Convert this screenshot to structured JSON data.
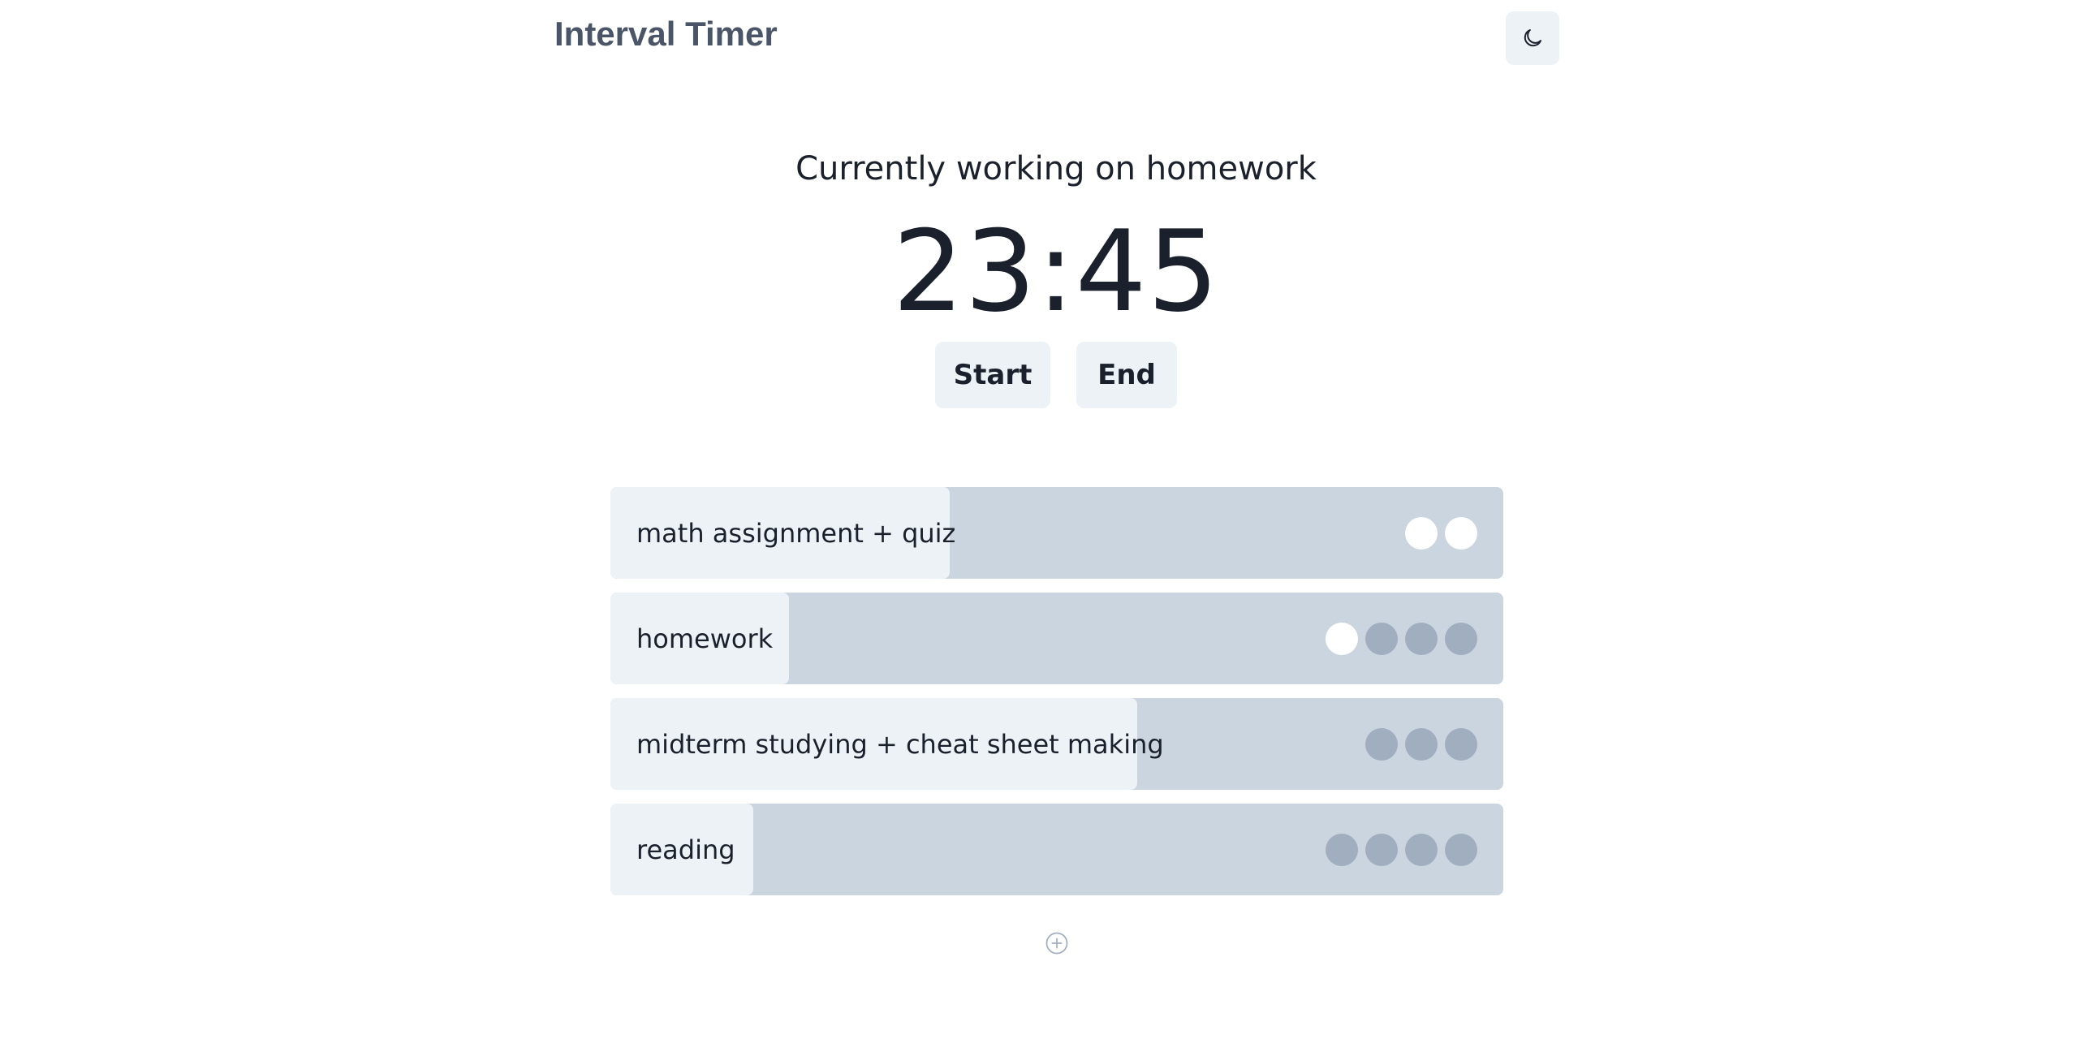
{
  "header": {
    "title": "Interval Timer",
    "theme_toggle_icon": "moon-icon"
  },
  "timer": {
    "status": "Currently working on homework",
    "display": "23:45",
    "start_label": "Start",
    "end_label": "End"
  },
  "tasks": [
    {
      "label": "math assignment + quiz",
      "progress_pct": 38,
      "intervals_done": 2,
      "intervals_total": 2
    },
    {
      "label": "homework",
      "progress_pct": 20,
      "intervals_done": 1,
      "intervals_total": 4
    },
    {
      "label": "midterm studying + cheat sheet making",
      "progress_pct": 59,
      "intervals_done": 0,
      "intervals_total": 3
    },
    {
      "label": "reading",
      "progress_pct": 16,
      "intervals_done": 0,
      "intervals_total": 4
    }
  ],
  "add_task_icon": "plus-circle-icon",
  "colors": {
    "accent_bg": "#edf2f7",
    "track": "#cbd5e0",
    "dot_pending": "#a0aec0",
    "dot_done": "#ffffff"
  }
}
